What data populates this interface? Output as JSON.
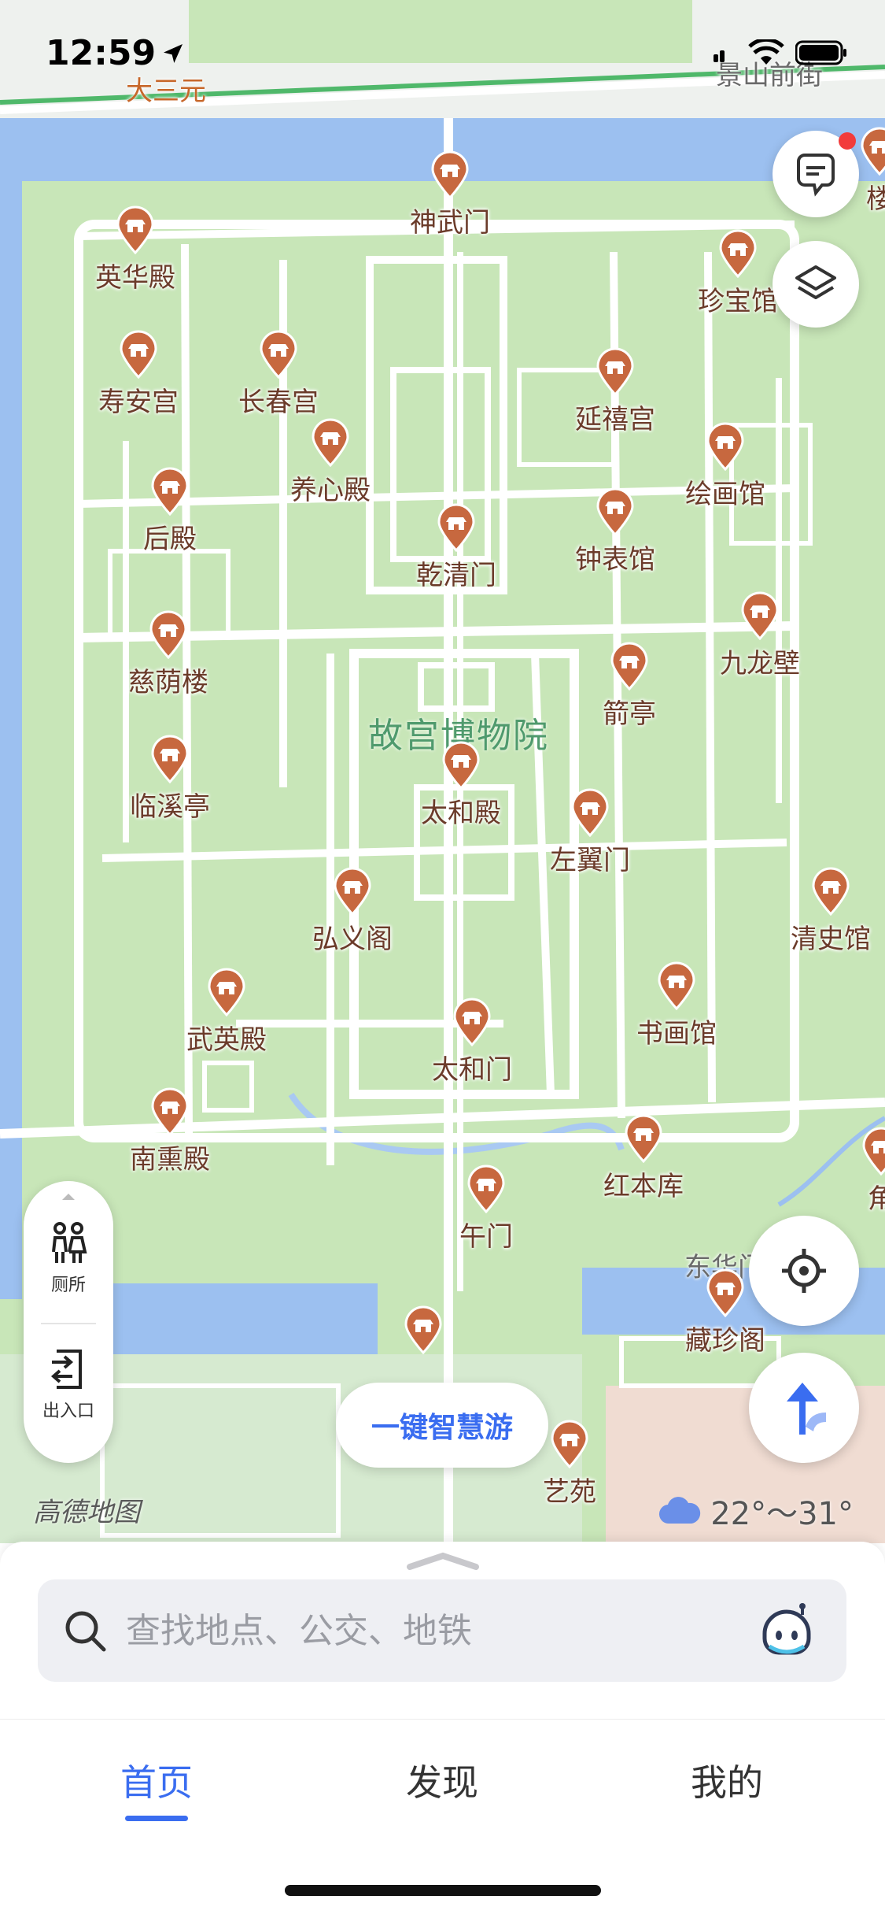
{
  "status_bar": {
    "time": "12:59"
  },
  "map": {
    "center_label": "故宫博物院",
    "street_labels": [
      {
        "text": "大三元",
        "color": "#c7672a"
      },
      {
        "text": "景山前街",
        "color": "#6a6a6a"
      },
      {
        "text": "东华门",
        "color": "#6a6a6a"
      }
    ],
    "pois": [
      {
        "name": "神武门"
      },
      {
        "name": "英华殿"
      },
      {
        "name": "珍宝馆"
      },
      {
        "name": "寿安宫"
      },
      {
        "name": "长春宫"
      },
      {
        "name": "延禧宫"
      },
      {
        "name": "养心殿"
      },
      {
        "name": "绘画馆"
      },
      {
        "name": "后殿"
      },
      {
        "name": "乾清门"
      },
      {
        "name": "钟表馆"
      },
      {
        "name": "九龙壁"
      },
      {
        "name": "慈荫楼"
      },
      {
        "name": "箭亭"
      },
      {
        "name": "临溪亭"
      },
      {
        "name": "太和殿"
      },
      {
        "name": "左翼门"
      },
      {
        "name": "弘义阁"
      },
      {
        "name": "清史馆"
      },
      {
        "name": "武英殿"
      },
      {
        "name": "书画馆"
      },
      {
        "name": "太和门"
      },
      {
        "name": "南熏殿"
      },
      {
        "name": "红本库"
      },
      {
        "name": "午门"
      },
      {
        "name": "藏珍阁"
      },
      {
        "name": "艺苑"
      },
      {
        "name": ""
      },
      {
        "name": "角"
      },
      {
        "name": "楼"
      }
    ],
    "logo": "高德地图",
    "weather": "22°～31°"
  },
  "side_panel": {
    "toilet_label": "厕所",
    "entrance_label": "出入口"
  },
  "tour_button": {
    "label": "一键智慧游"
  },
  "search": {
    "placeholder": "查找地点、公交、地铁"
  },
  "tabs": [
    {
      "label": "首页",
      "active": true
    },
    {
      "label": "发现",
      "active": false
    },
    {
      "label": "我的",
      "active": false
    }
  ],
  "colors": {
    "accent": "#3a6df0",
    "poi": "#c7683f",
    "map_green": "#c8e6b8",
    "water": "#9cc0f0",
    "road": "#ffffff"
  }
}
